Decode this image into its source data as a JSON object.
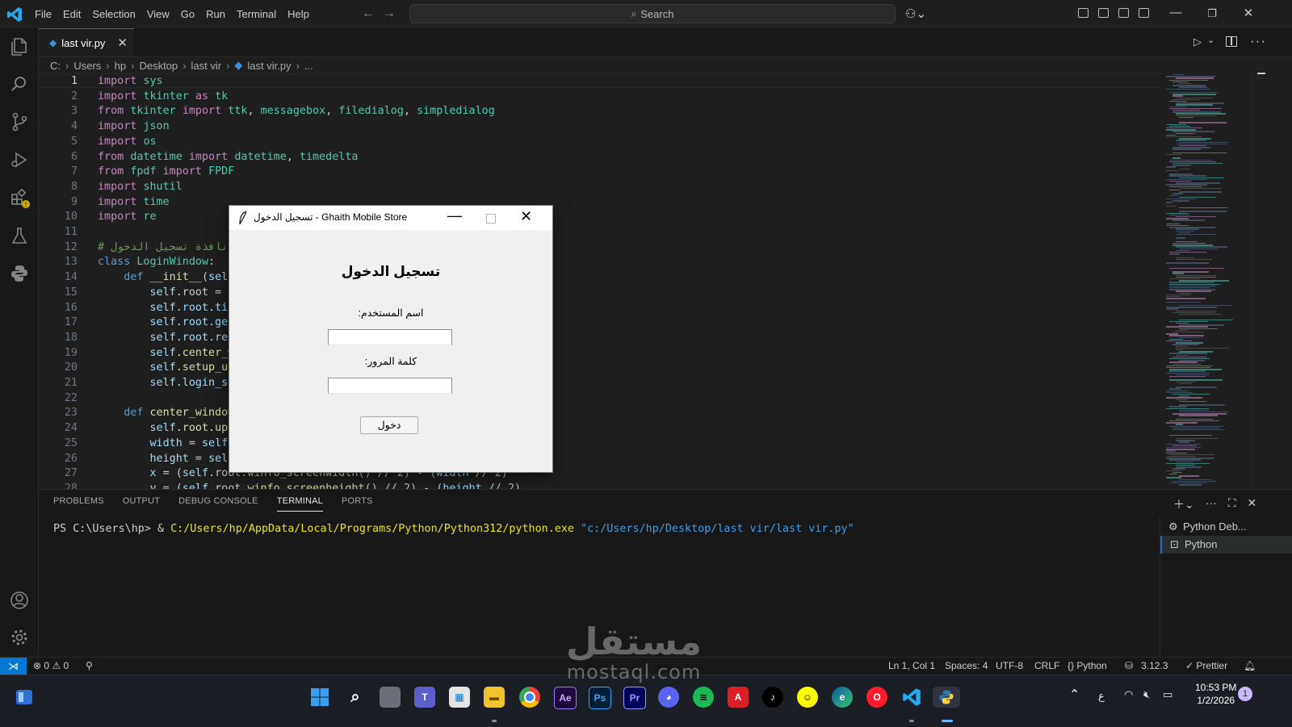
{
  "menu": [
    "File",
    "Edit",
    "Selection",
    "View",
    "Go",
    "Run",
    "Terminal",
    "Help"
  ],
  "search": {
    "label": "Search"
  },
  "tab": {
    "filename": "last vir.py"
  },
  "breadcrumb": [
    "C:",
    "Users",
    "hp",
    "Desktop",
    "last vir",
    "last vir.py",
    "..."
  ],
  "code": [
    [
      {
        "t": "import ",
        "c": "kw"
      },
      {
        "t": "sys",
        "c": "cls"
      }
    ],
    [
      {
        "t": "import ",
        "c": "kw"
      },
      {
        "t": "tkinter ",
        "c": "cls"
      },
      {
        "t": "as ",
        "c": "kw"
      },
      {
        "t": "tk",
        "c": "cls"
      }
    ],
    [
      {
        "t": "from ",
        "c": "kw"
      },
      {
        "t": "tkinter ",
        "c": "cls"
      },
      {
        "t": "import ",
        "c": "kw"
      },
      {
        "t": "ttk",
        "c": "cls"
      },
      {
        "t": ", ",
        "c": ""
      },
      {
        "t": "messagebox",
        "c": "cls"
      },
      {
        "t": ", ",
        "c": ""
      },
      {
        "t": "filedialog",
        "c": "cls"
      },
      {
        "t": ", ",
        "c": ""
      },
      {
        "t": "simpledialog",
        "c": "cls"
      }
    ],
    [
      {
        "t": "import ",
        "c": "kw"
      },
      {
        "t": "json",
        "c": "cls"
      }
    ],
    [
      {
        "t": "import ",
        "c": "kw"
      },
      {
        "t": "os",
        "c": "cls"
      }
    ],
    [
      {
        "t": "from ",
        "c": "kw"
      },
      {
        "t": "datetime ",
        "c": "cls"
      },
      {
        "t": "import ",
        "c": "kw"
      },
      {
        "t": "datetime",
        "c": "cls"
      },
      {
        "t": ", ",
        "c": ""
      },
      {
        "t": "timedelta",
        "c": "cls"
      }
    ],
    [
      {
        "t": "from ",
        "c": "kw"
      },
      {
        "t": "fpdf ",
        "c": "cls"
      },
      {
        "t": "import ",
        "c": "kw"
      },
      {
        "t": "FPDF",
        "c": "cls"
      }
    ],
    [
      {
        "t": "import ",
        "c": "kw"
      },
      {
        "t": "shutil",
        "c": "cls"
      }
    ],
    [
      {
        "t": "import ",
        "c": "kw"
      },
      {
        "t": "time",
        "c": "cls"
      }
    ],
    [
      {
        "t": "import ",
        "c": "kw"
      },
      {
        "t": "re",
        "c": "cls"
      }
    ],
    [],
    [
      {
        "t": "# نافذة تسجيل الدخول",
        "c": "cm"
      }
    ],
    [
      {
        "t": "class ",
        "c": "kw2"
      },
      {
        "t": "LoginWindow",
        "c": "cls"
      },
      {
        "t": ":",
        "c": ""
      }
    ],
    [
      {
        "t": "    ",
        "c": ""
      },
      {
        "t": "def ",
        "c": "kw2"
      },
      {
        "t": "__init__",
        "c": "fn"
      },
      {
        "t": "(",
        "c": ""
      },
      {
        "t": "self",
        "c": "vr"
      }
    ],
    [
      {
        "t": "        ",
        "c": ""
      },
      {
        "t": "self",
        "c": "vr"
      },
      {
        "t": ".root = ",
        "c": ""
      },
      {
        "t": "t",
        "c": "cls"
      }
    ],
    [
      {
        "t": "        ",
        "c": ""
      },
      {
        "t": "self",
        "c": "vr"
      },
      {
        "t": ".root.tit",
        "c": "vr"
      }
    ],
    [
      {
        "t": "        ",
        "c": ""
      },
      {
        "t": "self",
        "c": "vr"
      },
      {
        "t": ".root.geo",
        "c": "vr"
      }
    ],
    [
      {
        "t": "        ",
        "c": ""
      },
      {
        "t": "self",
        "c": "vr"
      },
      {
        "t": ".root.res",
        "c": "vr"
      }
    ],
    [
      {
        "t": "        ",
        "c": ""
      },
      {
        "t": "self",
        "c": "vr"
      },
      {
        "t": ".center_w",
        "c": "fn"
      }
    ],
    [
      {
        "t": "        ",
        "c": ""
      },
      {
        "t": "self",
        "c": "vr"
      },
      {
        "t": ".setup_ui",
        "c": "fn"
      }
    ],
    [
      {
        "t": "        ",
        "c": ""
      },
      {
        "t": "self",
        "c": "vr"
      },
      {
        "t": ".login_su",
        "c": "vr"
      }
    ],
    [],
    [
      {
        "t": "    ",
        "c": ""
      },
      {
        "t": "def ",
        "c": "kw2"
      },
      {
        "t": "center_window",
        "c": "fn"
      }
    ],
    [
      {
        "t": "        ",
        "c": ""
      },
      {
        "t": "self",
        "c": "vr"
      },
      {
        "t": ".root.upd",
        "c": "fn"
      }
    ],
    [
      {
        "t": "        ",
        "c": ""
      },
      {
        "t": "width",
        "c": "vr"
      },
      {
        "t": " = ",
        "c": ""
      },
      {
        "t": "self",
        "c": "vr"
      },
      {
        "t": ".",
        "c": ""
      }
    ],
    [
      {
        "t": "        ",
        "c": ""
      },
      {
        "t": "height",
        "c": "vr"
      },
      {
        "t": " = ",
        "c": ""
      },
      {
        "t": "self",
        "c": "vr"
      }
    ],
    [
      {
        "t": "        ",
        "c": ""
      },
      {
        "t": "x",
        "c": "vr"
      },
      {
        "t": " = (",
        "c": ""
      },
      {
        "t": "self",
        "c": "vr"
      },
      {
        "t": ".root.",
        "c": ""
      },
      {
        "t": "winfo_screenwidth",
        "c": "fn"
      },
      {
        "t": "() // ",
        "c": ""
      },
      {
        "t": "2",
        "c": "num"
      },
      {
        "t": ") - (",
        "c": ""
      },
      {
        "t": "width",
        "c": "vr"
      },
      {
        "t": " // ",
        "c": ""
      },
      {
        "t": "2",
        "c": "num"
      },
      {
        "t": ")",
        "c": ""
      }
    ],
    [
      {
        "t": "        ",
        "c": ""
      },
      {
        "t": "y",
        "c": "vr"
      },
      {
        "t": " = (",
        "c": ""
      },
      {
        "t": "self",
        "c": "vr"
      },
      {
        "t": ".root.",
        "c": ""
      },
      {
        "t": "winfo_screenheight",
        "c": "fn"
      },
      {
        "t": "() // ",
        "c": ""
      },
      {
        "t": "2",
        "c": "num"
      },
      {
        "t": ") - (",
        "c": ""
      },
      {
        "t": "height",
        "c": "vr"
      },
      {
        "t": " // ",
        "c": ""
      },
      {
        "t": "2",
        "c": "num"
      },
      {
        "t": ")",
        "c": ""
      }
    ]
  ],
  "panel": {
    "tabs": [
      "PROBLEMS",
      "OUTPUT",
      "DEBUG CONSOLE",
      "TERMINAL",
      "PORTS"
    ],
    "active_tab": "TERMINAL",
    "terminal": {
      "prompt": "PS C:\\Users\\hp> & ",
      "exe": "C:/Users/hp/AppData/Local/Programs/Python/Python312/python.exe",
      "arg": " \"c:/Users/hp/Desktop/last vir/last vir.py\""
    },
    "terminals": [
      "Python Deb...",
      "Python"
    ]
  },
  "status": {
    "errors": "0",
    "warnings": "0",
    "cursor": "Ln 1, Col 1",
    "spaces": "Spaces: 4",
    "encoding": "UTF-8",
    "eol": "CRLF",
    "language": "Python",
    "python_version": "3.12.3",
    "formatter": "Prettier"
  },
  "dialog": {
    "title": "تسجيل الدخول - Ghaith Mobile Store",
    "heading": "تسجيل الدخول",
    "username_label": "اسم المستخدم:",
    "password_label": "كلمة المرور:",
    "login_button": "دخول"
  },
  "taskbar": {
    "apps": [
      "start",
      "search",
      "task-view",
      "teams",
      "store",
      "file-explorer",
      "chrome",
      "after-effects",
      "photoshop",
      "premiere",
      "discord",
      "spotify",
      "acrobat",
      "tiktok",
      "snapchat",
      "edge",
      "opera",
      "vscode",
      "python"
    ],
    "language": "ع",
    "time": "10:53 PM",
    "date": "1/2/2026",
    "notification_count": "1"
  },
  "watermark": {
    "arabic": "مستقل",
    "latin": "mostaql.com"
  },
  "colors": {
    "accent": "#0078d4",
    "editor_bg": "#1f1f1f",
    "dialog_bg": "#f0f0f0"
  }
}
